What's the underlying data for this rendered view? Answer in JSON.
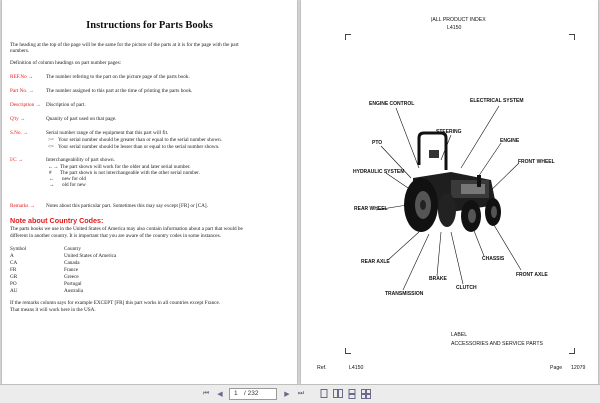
{
  "left": {
    "title": "Instructions for Parts Books",
    "intro_1": "The heading at the top of the page will be the same for the picture of the parts at it is for the page with the part",
    "intro_2": "numbers.",
    "definition": "Definition of column headings on part number pages:",
    "refno_label": "REF.No →",
    "refno_text": "The number refering to the part on the picture page of the parts book.",
    "partno_label": "Part No. →",
    "partno_text": "The number assigned to this part at the time of printing the parts book.",
    "desc_label": "Description →",
    "desc_text": "Discription of part.",
    "qty_label": "Q'ty →",
    "qty_text": "Quanity of part used on that page.",
    "sno_label": "S.No. →",
    "sno_text": "Serial number range of the equipment that this part will fit.",
    "sno_sym1": ">=",
    "sno_line1": "Your serial number should be greater than or equal to the serial number shown.",
    "sno_sym2": "<=",
    "sno_line2": "Your serial number should be lesser than or equal to the serial number shown.",
    "ic_label": "I/C →",
    "ic_text": "Interchangeability of part shown.",
    "ic_sym1": "←→",
    "ic_line1": "The part shown will work for the older and later serial number.",
    "ic_sym2": "#",
    "ic_line2": "The part shown is not interchangeable with the other serial number.",
    "ic_sym3": "←",
    "ic_line3": "new for old",
    "ic_sym4": "→",
    "ic_line4": "old for new",
    "remarks_label": "Remarks →",
    "remarks_text": "Notes about this particular part. Sometimes this may say except [FR] or [CA].",
    "country_heading": "Note about Country Codes:",
    "country_1": "The parts books we use in the United States of America may also contain information about a part that would be",
    "country_2": "different in another country. It is important that you are aware of the country codes in some instances.",
    "codes_header": [
      "Symbol",
      "Country"
    ],
    "codes": [
      [
        "A",
        "United States of America"
      ],
      [
        "CA",
        "Canada"
      ],
      [
        "FR",
        "France"
      ],
      [
        "GR",
        "Greece"
      ],
      [
        "PO",
        "Portugal"
      ],
      [
        "AU",
        "Australia"
      ]
    ],
    "closing_1": "If the remarks column says for example EXCEPT [FR] this part works in all countries except France.",
    "closing_2": "That means it will work here in the USA."
  },
  "right": {
    "header_1": "|ALL PRODUCT INDEX",
    "header_2": "L4150",
    "labels": {
      "engine_control": "ENGINE CONTROL",
      "electrical_system": "ELECTRICAL SYSTEM",
      "steering": "STEERING",
      "engine": "ENGINE",
      "pto": "PTO",
      "front_wheel": "FRONT WHEEL",
      "hydraulic_system": "HYDRAULIC SYSTEM",
      "rear_wheel": "REAR WHEEL",
      "chassis": "CHASSIS",
      "rear_axle": "REAR AXLE",
      "front_axle": "FRONT AXLE",
      "brake": "BRAKE",
      "clutch": "CLUTCH",
      "transmission": "TRANSMISSION"
    },
    "label_title": "LABEL",
    "accessories": "ACCESSORIES AND SERVICE PARTS",
    "ref_label": "Ref.",
    "ref_value": "L4150",
    "page_label": "Page",
    "page_value": "12079"
  },
  "toolbar": {
    "current_page": "1",
    "total_pages": "/ 232"
  }
}
